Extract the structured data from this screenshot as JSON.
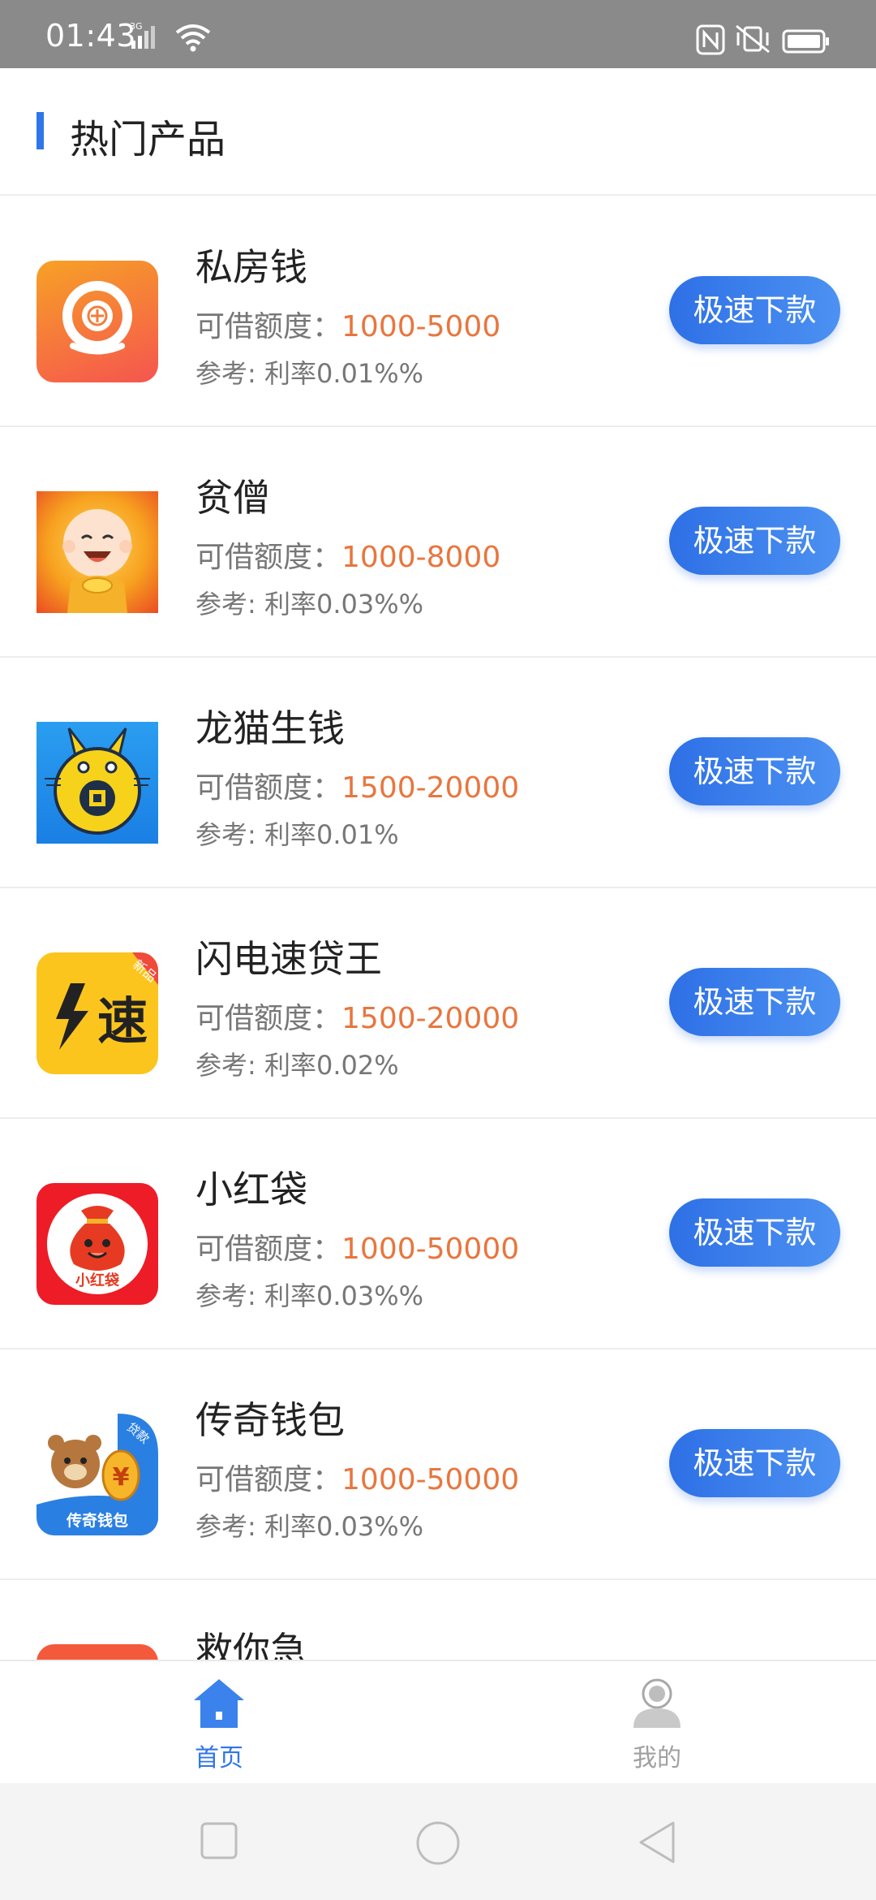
{
  "status_bar": {
    "time": "01:43",
    "network": "3G"
  },
  "header": {
    "title": "热门产品"
  },
  "colors": {
    "accent": "#2f76e8",
    "amount": "#e8763e",
    "button": "#3a7cec"
  },
  "products": [
    {
      "name": "私房钱",
      "limit_label": "可借额度：",
      "limit_value": "1000-5000",
      "rate": "参考: 利率0.01%%",
      "button": "极速下款"
    },
    {
      "name": "贫僧",
      "limit_label": "可借额度：",
      "limit_value": "1000-8000",
      "rate": "参考: 利率0.03%%",
      "button": "极速下款"
    },
    {
      "name": "龙猫生钱",
      "limit_label": "可借额度：",
      "limit_value": "1500-20000",
      "rate": "参考: 利率0.01%",
      "button": "极速下款"
    },
    {
      "name": "闪电速贷王",
      "limit_label": "可借额度：",
      "limit_value": "1500-20000",
      "rate": "参考: 利率0.02%",
      "button": "极速下款",
      "logo_text": "速",
      "logo_badge": "新品"
    },
    {
      "name": "小红袋",
      "limit_label": "可借额度：",
      "limit_value": "1000-50000",
      "rate": "参考: 利率0.03%%",
      "button": "极速下款",
      "logo_text": "小红袋"
    },
    {
      "name": "传奇钱包",
      "limit_label": "可借额度：",
      "limit_value": "1000-50000",
      "rate": "参考: 利率0.03%%",
      "button": "极速下款",
      "logo_text": "传奇钱包",
      "logo_badge": "贷款"
    },
    {
      "name": "救你急"
    }
  ],
  "tabs": [
    {
      "label": "首页",
      "icon": "home-icon",
      "active": true
    },
    {
      "label": "我的",
      "icon": "profile-icon",
      "active": false
    }
  ],
  "nav": {
    "recent": "recent-apps-icon",
    "home": "home-circle-icon",
    "back": "back-icon"
  }
}
